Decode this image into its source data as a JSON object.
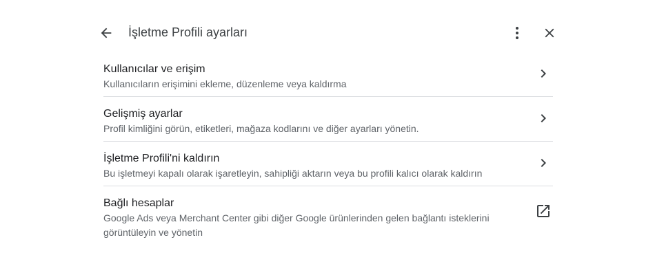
{
  "header": {
    "title": "İşletme Profili ayarları",
    "back_icon": "arrow-back-icon",
    "more_icon": "more-vert-icon",
    "close_icon": "close-icon"
  },
  "items": [
    {
      "title": "Kullanıcılar ve erişim",
      "description": "Kullanıcıların erişimini ekleme, düzenleme veya kaldırma",
      "icon": "chevron-right-icon"
    },
    {
      "title": "Gelişmiş ayarlar",
      "description": "Profil kimliğini görün, etiketleri, mağaza kodlarını ve diğer ayarları yönetin.",
      "icon": "chevron-right-icon"
    },
    {
      "title": "İşletme Profili'ni kaldırın",
      "description": "Bu işletmeyi kapalı olarak işaretleyin, sahipliği aktarın veya bu profili kalıcı olarak kaldırın",
      "icon": "chevron-right-icon"
    },
    {
      "title": "Bağlı hesaplar",
      "description": "Google Ads veya Merchant Center gibi diğer Google ürünlerinden gelen bağlantı isteklerini görüntüleyin ve yönetin",
      "icon": "open-in-new-icon"
    }
  ],
  "colors": {
    "title_text": "#3c4043",
    "item_title": "#202124",
    "item_desc": "#5f6368",
    "divider": "#dadce0",
    "icon": "#3c4043"
  }
}
